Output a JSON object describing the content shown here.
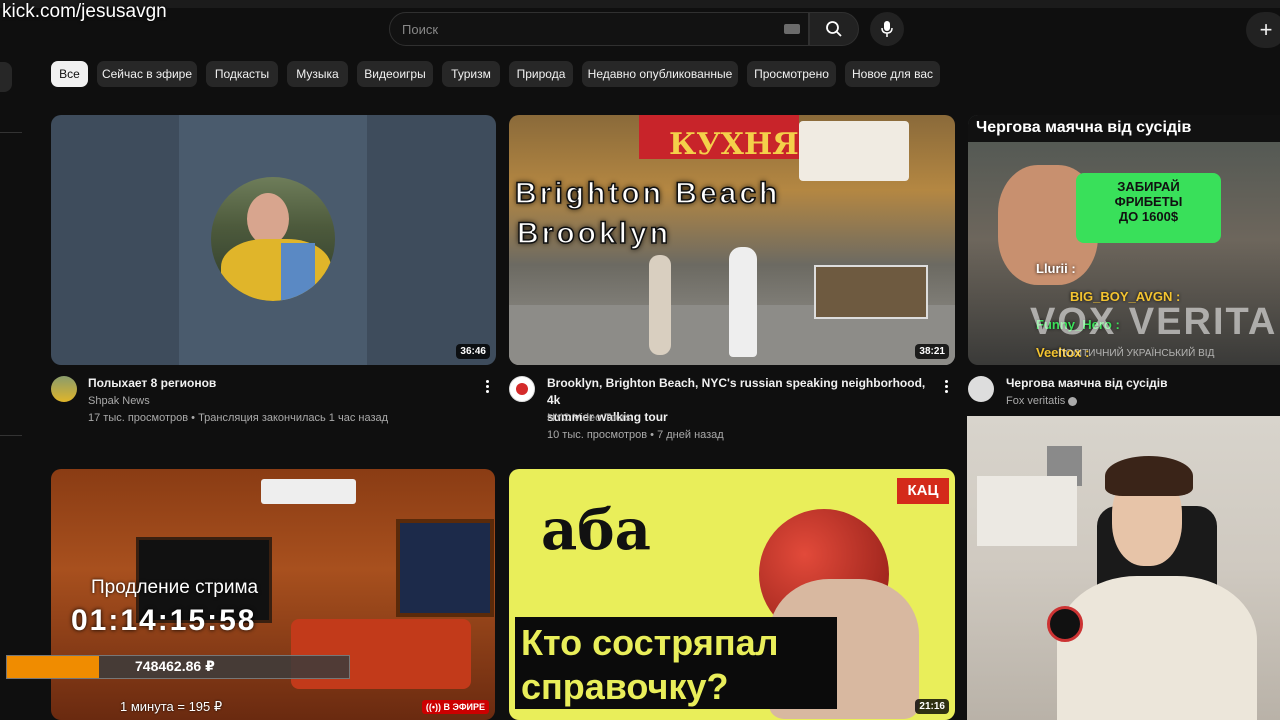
{
  "watermark": "kick.com/jesusavgn",
  "search": {
    "placeholder": "Поиск"
  },
  "chips": [
    "Все",
    "Сейчас в эфире",
    "Подкасты",
    "Музыка",
    "Видеоигры",
    "Туризм",
    "Природа",
    "Недавно опубликованные",
    "Просмотрено",
    "Новое для вас"
  ],
  "videos": [
    {
      "title": "Полыхает 8 регионов",
      "channel": "Shpak News",
      "views": "17 тыс. просмотров",
      "age": "Трансляция закончилась 1 час назад",
      "duration": "36:46"
    },
    {
      "title_line1": "Brooklyn, Brighton Beach, NYC's russian speaking neighborhood, 4k",
      "title_line2": "summer walking tour",
      "channel": "NYC Video Tours",
      "views": "10 тыс. просмотров",
      "age": "7 дней назад",
      "duration": "38:21",
      "thumb_text": [
        "Brighton Beach",
        "Brooklyn"
      ],
      "sign_text": "КУХНЯ"
    },
    {
      "title": "Чергова маячна від сусідів",
      "channel": "Fox veritatis",
      "thumb_title": "Чергова маячна від сусідів",
      "promo": [
        "ЗАБИРАЙ",
        "ФРИБЕТЫ",
        "ДО 1600$"
      ],
      "chat": [
        "Llurii :",
        "BIG_BOY_AVGN :",
        "Funny_Hero :",
        "Veeltox :"
      ],
      "brand": "VOX VERITA",
      "brand_sub": "ПОЛІТИЧНИЙ УКРАЇНСЬКИЙ ВІД"
    },
    {
      "live_badge": "В ЭФИРЕ",
      "overlay_label": "Продление стрима",
      "timer": "01:14:15:58"
    },
    {
      "duration": "21:16",
      "headline_line1": "Кто состряпал",
      "headline_line2": "справочку?",
      "tag": "КАЦ",
      "brand": "аба"
    }
  ],
  "donation": {
    "amount": "748462.86 ₽",
    "rate": "1 минута = 195 ₽",
    "progress": 0.27
  },
  "colors": {
    "accent": "#f08c00",
    "bg": "#0f0f0f",
    "live": "#cc0000"
  },
  "icons": [
    "search-icon",
    "keyboard-icon",
    "mic-icon",
    "create-icon",
    "more-vert-icon",
    "verified-icon",
    "live-icon"
  ]
}
